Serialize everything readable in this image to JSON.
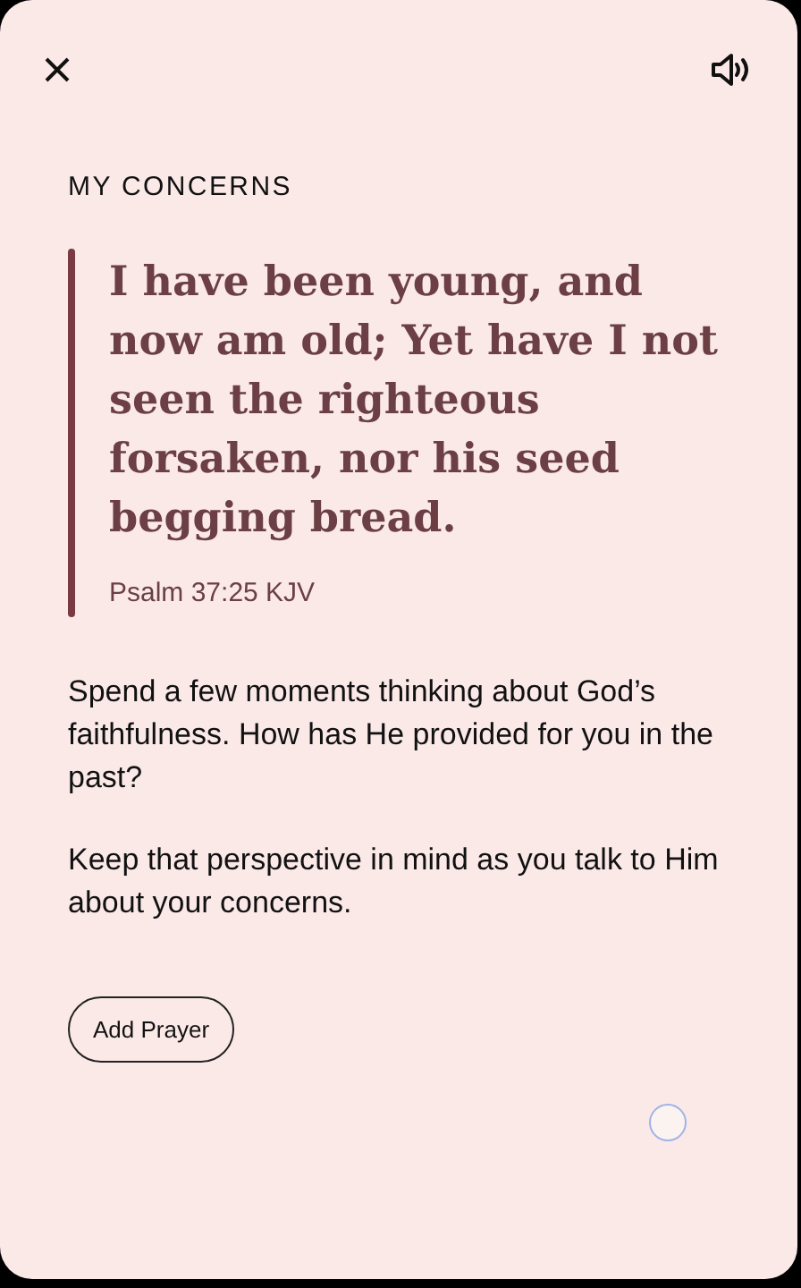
{
  "header": {
    "title": "MY CONCERNS"
  },
  "quote": {
    "text": "I have been young, and now am old; Yet have I not seen the righteous forsaken, nor his seed begging bread.",
    "reference": "Psalm 37:25 KJV"
  },
  "paragraphs": [
    "Spend a few moments thinking about God’s faithfulness. How has He provided for you in the past?",
    "Keep that perspective in mind as you talk to Him about your concerns."
  ],
  "button": {
    "label": "Add Prayer"
  }
}
